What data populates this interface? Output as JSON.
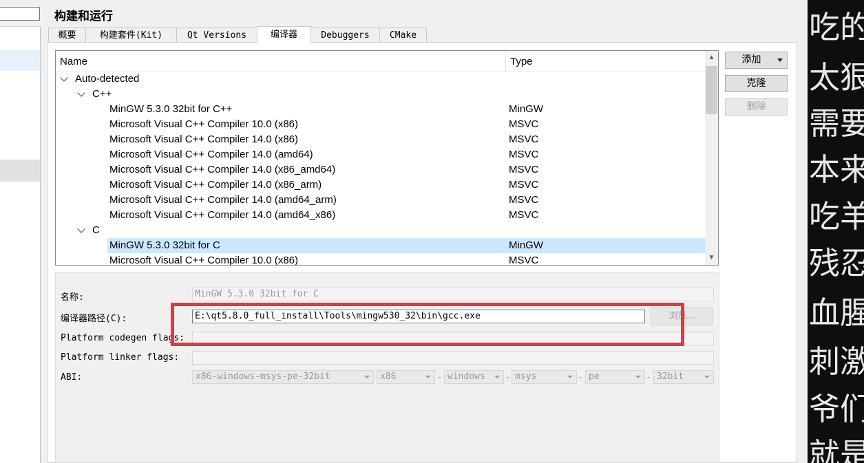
{
  "page_title": "构建和运行",
  "tabs": [
    {
      "label": "概要"
    },
    {
      "label": "构建套件(Kit)"
    },
    {
      "label": "Qt Versions"
    },
    {
      "label": "编译器"
    },
    {
      "label": "Debuggers"
    },
    {
      "label": "CMake"
    }
  ],
  "active_tab": "编译器",
  "tree": {
    "col_name": "Name",
    "col_type": "Type",
    "root": "Auto-detected",
    "groups": [
      {
        "label": "C++",
        "items": [
          {
            "name": "MinGW 5.3.0 32bit for C++",
            "type": "MinGW"
          },
          {
            "name": "Microsoft Visual C++ Compiler 10.0 (x86)",
            "type": "MSVC"
          },
          {
            "name": "Microsoft Visual C++ Compiler 14.0 (x86)",
            "type": "MSVC"
          },
          {
            "name": "Microsoft Visual C++ Compiler 14.0 (amd64)",
            "type": "MSVC"
          },
          {
            "name": "Microsoft Visual C++ Compiler 14.0 (x86_amd64)",
            "type": "MSVC"
          },
          {
            "name": "Microsoft Visual C++ Compiler 14.0 (x86_arm)",
            "type": "MSVC"
          },
          {
            "name": "Microsoft Visual C++ Compiler 14.0 (amd64_arm)",
            "type": "MSVC"
          },
          {
            "name": "Microsoft Visual C++ Compiler 14.0 (amd64_x86)",
            "type": "MSVC"
          }
        ]
      },
      {
        "label": "C",
        "items": [
          {
            "name": "MinGW 5.3.0 32bit for C",
            "type": "MinGW"
          },
          {
            "name": "Microsoft Visual C++ Compiler 10.0 (x86)",
            "type": "MSVC"
          }
        ]
      }
    ]
  },
  "buttons": {
    "add": "添加",
    "clone": "克隆",
    "remove": "删除",
    "browse": "浏览..."
  },
  "details": {
    "name_label": "名称:",
    "name_value": "MinGW 5.3.0 32bit for C",
    "path_label": "编译器路径(C):",
    "path_value": "E:\\qt5.8.0_full_install\\Tools\\mingw530_32\\bin\\gcc.exe",
    "codegen_label": "Platform codegen flags:",
    "codegen_value": "",
    "linker_label": "Platform linker flags:",
    "linker_value": "",
    "abi_label": "ABI:",
    "abi_values": [
      "x86-windows-msys-pe-32bit",
      "x86",
      "windows",
      "msys",
      "pe",
      "32bit"
    ],
    "abi_separator": "-"
  },
  "right_strip_lines": [
    "吃的",
    "太狠",
    "需要",
    "本来",
    "吃羊",
    "残忍",
    "血腥",
    "刺激",
    "爷们",
    "就是"
  ],
  "colors": {
    "selection": "#cce8ff",
    "highlight_box": "#e8373c",
    "right_strip_bg": "#0d0f0e"
  }
}
